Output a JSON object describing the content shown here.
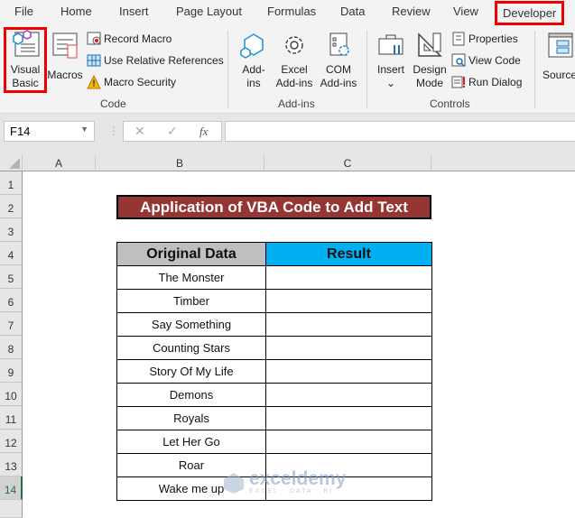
{
  "ribbon_tabs": [
    "File",
    "Home",
    "Insert",
    "Page Layout",
    "Formulas",
    "Data",
    "Review",
    "View",
    "Developer"
  ],
  "active_tab": "Developer",
  "code_group": {
    "label": "Code",
    "visual_basic": [
      "Visual",
      "Basic"
    ],
    "macros": "Macros",
    "record_macro": "Record Macro",
    "use_relative": "Use Relative References",
    "macro_security": "Macro Security"
  },
  "addins_group": {
    "label": "Add-ins",
    "addins": [
      "Add-",
      "ins"
    ],
    "excel_addins": [
      "Excel",
      "Add-ins"
    ],
    "com_addins": [
      "COM",
      "Add-ins"
    ]
  },
  "controls_group": {
    "label": "Controls",
    "insert": "Insert",
    "insert_chevron": "⌄",
    "design_mode": [
      "Design",
      "Mode"
    ],
    "properties": "Properties",
    "view_code": "View Code",
    "run_dialog": "Run Dialog"
  },
  "source_label": "Source",
  "formula_bar": {
    "name_box": "F14",
    "cancel": "✕",
    "enter": "✓",
    "fx": "fx",
    "formula": ""
  },
  "columns": [
    "A",
    "B",
    "C"
  ],
  "rows": [
    "1",
    "2",
    "3",
    "4",
    "5",
    "6",
    "7",
    "8",
    "9",
    "10",
    "11",
    "12",
    "13",
    "14"
  ],
  "selected_row": "14",
  "sheet": {
    "title": "Application of VBA Code to Add Text",
    "headers": [
      "Original Data",
      "Result"
    ],
    "data": [
      [
        "The Monster",
        ""
      ],
      [
        "Timber",
        ""
      ],
      [
        "Say Something",
        ""
      ],
      [
        "Counting Stars",
        ""
      ],
      [
        "Story Of My Life",
        ""
      ],
      [
        "Demons",
        ""
      ],
      [
        "Royals",
        ""
      ],
      [
        "Let Her Go",
        ""
      ],
      [
        "Roar",
        ""
      ],
      [
        "Wake me up",
        ""
      ]
    ]
  },
  "watermark": {
    "brand": "exceldemy",
    "tagline": "EXCEL · DATA · BI"
  },
  "colors": {
    "title_bg": "#963634",
    "orig_header_bg": "#bfbfbf",
    "result_header_bg": "#00b0f0",
    "highlight": "#ee0000"
  }
}
